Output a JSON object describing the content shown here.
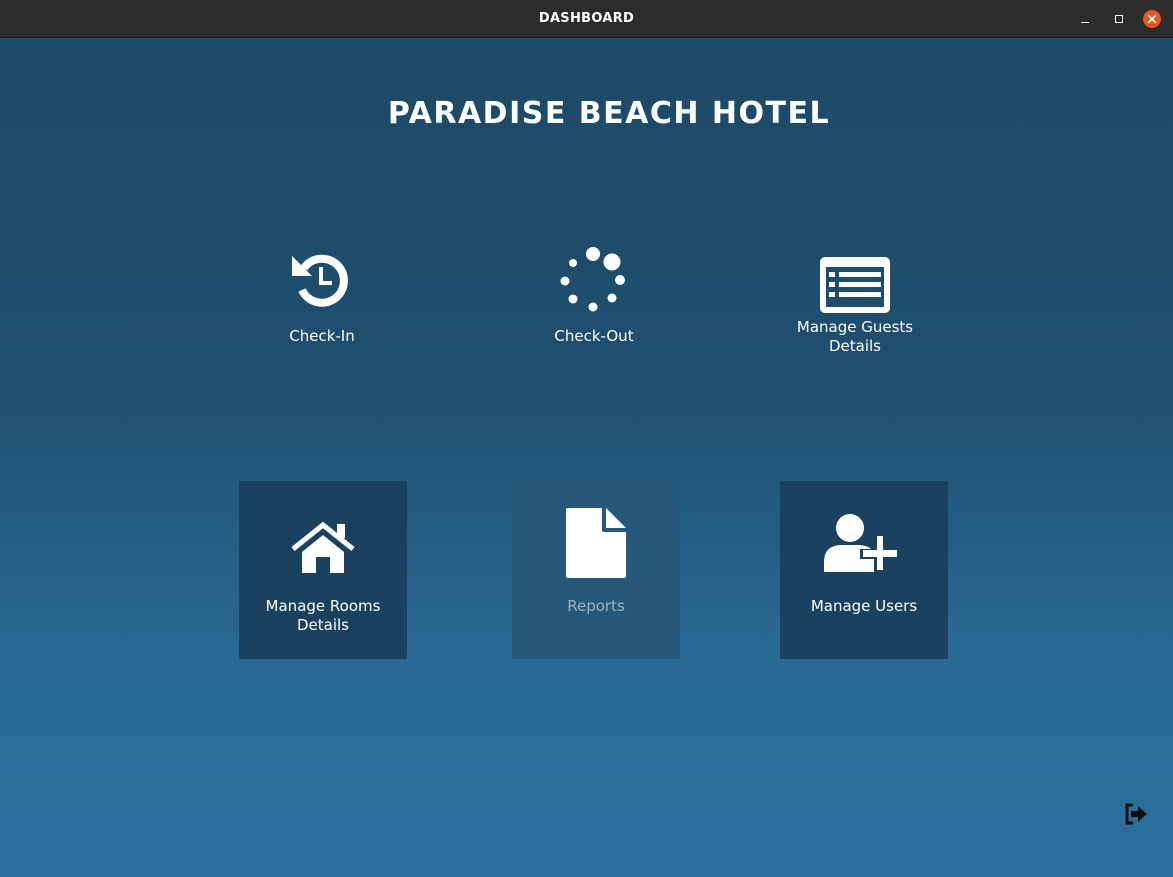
{
  "window": {
    "title": "DASHBOARD"
  },
  "main": {
    "hotel_name": "PARADISE BEACH HOTEL",
    "tiles": [
      {
        "label": "Check-In",
        "icon": "history-icon"
      },
      {
        "label": "Check-Out",
        "icon": "spinner-icon"
      },
      {
        "label_line1": "Manage Guests",
        "label_line2": "Details",
        "icon": "list-alt-icon"
      },
      {
        "label_line1": "Manage Rooms",
        "label_line2": "Details",
        "icon": "home-icon"
      },
      {
        "label": "Reports",
        "icon": "file-icon",
        "state": "disabled"
      },
      {
        "label": "Manage Users",
        "icon": "user-plus-icon"
      }
    ]
  },
  "colors": {
    "titlebar": "#2c2c2c",
    "background_top": "#1d4a67",
    "background_bottom": "#2b6f9c",
    "tile_dark": "#1a4260",
    "tile_faint": "#25587b",
    "close_button": "#e95420"
  },
  "footer": {
    "logout_icon": "sign-out-icon"
  }
}
